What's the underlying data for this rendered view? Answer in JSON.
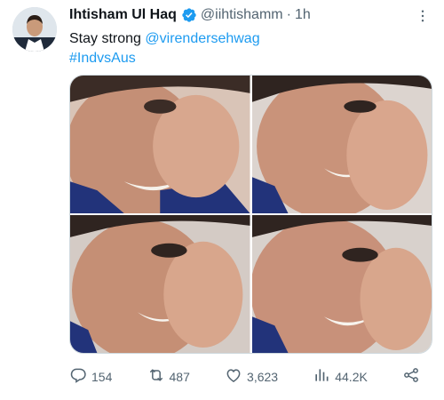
{
  "author": {
    "display_name": "Ihtisham Ul Haq",
    "handle": "@iihtishamm",
    "time": "1h",
    "verified_icon": "verified-badge-icon"
  },
  "tweet": {
    "text_line1": "Stay strong",
    "mention": "@virendersehwag",
    "hashtag": "#IndvsAus"
  },
  "actions": {
    "replies": "154",
    "retweets": "487",
    "likes": "3,623",
    "views": "44.2K"
  },
  "colors": {
    "accent": "#1d9bf0",
    "secondary_text": "#536471",
    "primary_text": "#0f1419",
    "border": "#cfd9de"
  },
  "icons": [
    "more-icon",
    "reply-icon",
    "retweet-icon",
    "like-icon",
    "views-icon",
    "share-icon"
  ]
}
